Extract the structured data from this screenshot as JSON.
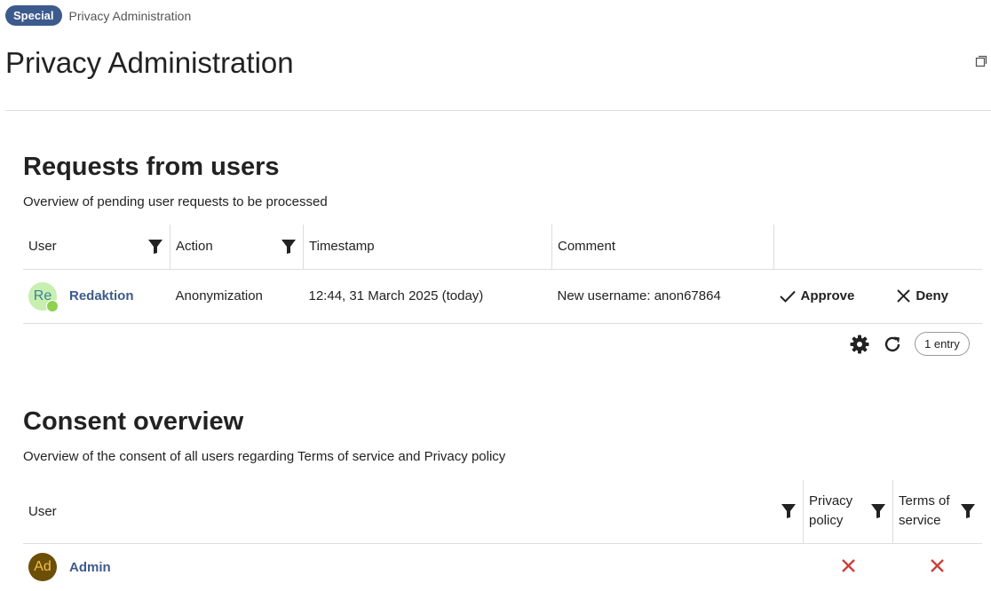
{
  "breadcrumb": {
    "badge": "Special",
    "current": "Privacy Administration"
  },
  "page": {
    "title": "Privacy Administration"
  },
  "requests": {
    "title": "Requests from users",
    "description": "Overview of pending user requests to be processed",
    "columns": {
      "user": "User",
      "action": "Action",
      "timestamp": "Timestamp",
      "comment": "Comment"
    },
    "rows": [
      {
        "avatar_initials": "Re",
        "user": "Redaktion",
        "action": "Anonymization",
        "timestamp": "12:44, 31 March 2025 (today)",
        "comment": "New username: anon67864",
        "approve_label": "Approve",
        "deny_label": "Deny"
      }
    ],
    "entry_count": "1 entry"
  },
  "consent": {
    "title": "Consent overview",
    "description": "Overview of the consent of all users regarding Terms of service and Privacy policy",
    "columns": {
      "user": "User",
      "privacy_policy": "Privacy policy",
      "terms_of_service": "Terms of service"
    },
    "rows": [
      {
        "avatar_initials": "Ad",
        "user": "Admin",
        "privacy_policy": "✕",
        "terms_of_service": "✕"
      }
    ]
  },
  "colors": {
    "accent": "#3d5a8c",
    "deny_red": "#c8403a",
    "divider": "#dddddd"
  },
  "icons": [
    "expand-icon",
    "filter-icon",
    "check-icon",
    "close-icon",
    "gear-icon",
    "refresh-icon"
  ]
}
